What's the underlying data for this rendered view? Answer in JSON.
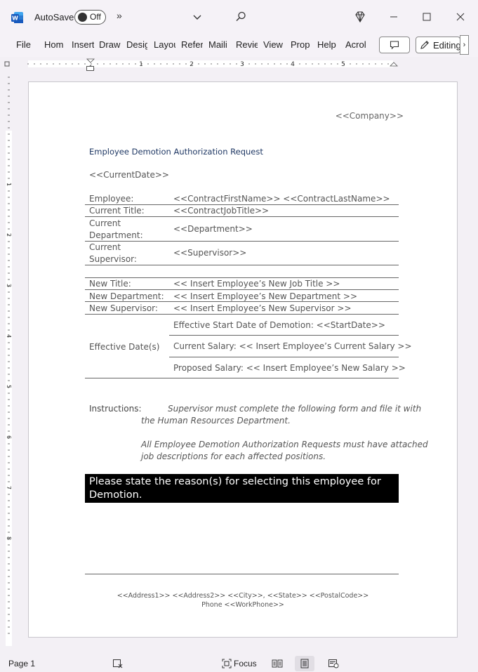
{
  "titlebar": {
    "autosave_label": "AutoSave",
    "autosave_state": "Off",
    "overflow_label": "»"
  },
  "ribbon": {
    "tabs": [
      "File",
      "Home",
      "Insert",
      "Draw",
      "Design",
      "Layout",
      "References",
      "Mailings",
      "Review",
      "View",
      "Properties",
      "Help",
      "Acrobat"
    ],
    "tabs_display": [
      "File",
      "Hom",
      "Insert",
      "Draw",
      "Desig",
      "Layou",
      "Refer",
      "Maili",
      "Revie",
      "View",
      "Prop",
      "Help",
      "Acrol"
    ],
    "editing_label": "Editing",
    "more_label": "›"
  },
  "ruler": {
    "h_numbers": [
      "1",
      "2",
      "3",
      "4",
      "5"
    ],
    "v_numbers": [
      "1",
      "2",
      "3",
      "4",
      "5",
      "6",
      "7",
      "8"
    ]
  },
  "document": {
    "company": "<<Company>>",
    "title": "Employee Demotion Authorization Request",
    "current_date": "<<CurrentDate>>",
    "fields": [
      {
        "label": "Employee:",
        "value": "<<ContractFirstName>> <<ContractLastName>>"
      },
      {
        "label": "Current Title:",
        "value": "<<ContractJobTitle>>"
      },
      {
        "label_line1": "Current",
        "label_line2": "Department:",
        "value": "<<Department>>"
      },
      {
        "label_line1": "Current",
        "label_line2": "Supervisor:",
        "value": "<<Supervisor>>"
      }
    ],
    "new_fields": [
      {
        "label": "New Title:",
        "value": "<< Insert Employee’s New Job Title >>"
      },
      {
        "label": "New Department:",
        "value": "<< Insert Employee’s New Department >>"
      },
      {
        "label": "New Supervisor:",
        "value": "<< Insert Employee’s New Supervisor >>"
      }
    ],
    "effective": {
      "label": "Effective Date(s)",
      "rows": [
        "Effective Start Date of Demotion: <<StartDate>>",
        "Current Salary: << Insert Employee’s Current Salary >>",
        "Proposed Salary: << Insert Employee’s New Salary >>"
      ]
    },
    "instructions": {
      "label": "Instructions:",
      "p1_line1": "Supervisor must complete the following form and file it with",
      "p1_line2": "the Human Resources Department.",
      "p2_line1": "All Employee Demotion Authorization Requests must have attached",
      "p2_line2": "job descriptions for each affected positions."
    },
    "reason_line1": "Please state the reason(s) for selecting this employee for",
    "reason_line2": "Demotion.",
    "footer": {
      "address": "<<Address1>> <<Address2>> <<City>>, <<State>> <<PostalCode>>",
      "phone": "Phone <<WorkPhone>>"
    }
  },
  "statusbar": {
    "page": "Page 1",
    "focus": "Focus"
  }
}
